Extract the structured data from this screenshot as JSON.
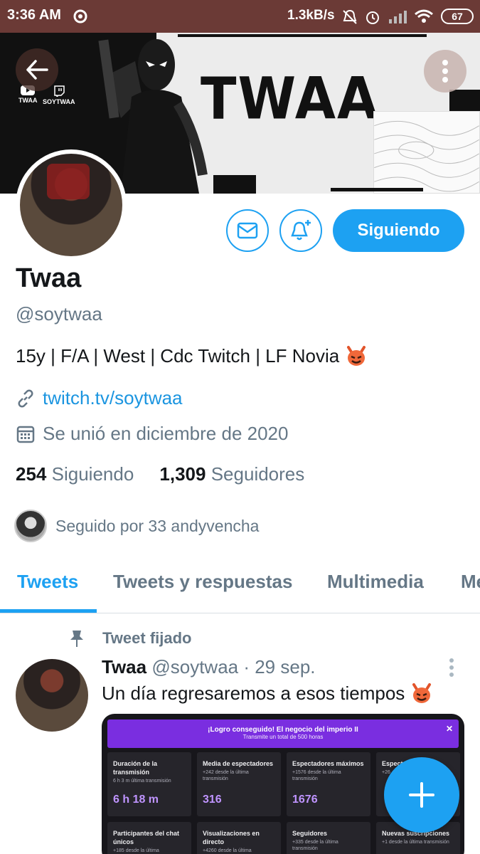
{
  "status_bar": {
    "time": "3:36 AM",
    "net_speed": "1.3kB/s",
    "battery": "67"
  },
  "banner": {
    "word": "TWAA",
    "social_1": "TWAA",
    "social_2": "SOYTWAA"
  },
  "profile": {
    "name": "Twaa",
    "handle": "@soytwaa",
    "bio": "15y | F/A | West | Cdc Twitch | LF Novia",
    "link": "twitch.tv/soytwaa",
    "joined": "Se unió en diciembre de 2020",
    "following_count": "254",
    "following_label": "Siguiendo",
    "followers_count": "1,309",
    "followers_label": "Seguidores",
    "followed_by": "Seguido por 33 andyvencha",
    "follow_button": "Siguiendo"
  },
  "tabs": [
    {
      "label": "Tweets",
      "active": true
    },
    {
      "label": "Tweets y respuestas",
      "active": false
    },
    {
      "label": "Multimedia",
      "active": false
    },
    {
      "label": "Me",
      "active": false
    }
  ],
  "tweet": {
    "pinned_label": "Tweet fijado",
    "author": "Twaa",
    "handle_date": "@soytwaa · 29 sep.",
    "text": "Un día regresaremos a esos tiempos",
    "media": {
      "title": "¡Logro conseguido! El negocio del imperio II",
      "subtitle": "Transmite un total de 500 horas",
      "cards": [
        {
          "title": "Duración de la transmisión",
          "sub": "6 h 3 m última transmisión",
          "value": "6 h 18 m"
        },
        {
          "title": "Media de espectadores",
          "sub": "+242 desde la última transmisión",
          "value": "316"
        },
        {
          "title": "Espectadores máximos",
          "sub": "+1576 desde la última transmisión",
          "value": "1676"
        },
        {
          "title": "Espectadores",
          "sub": "+26",
          "value": ""
        },
        {
          "title": "Participantes del chat únicos",
          "sub": "+185 desde la última",
          "value": ""
        },
        {
          "title": "Visualizaciones en directo",
          "sub": "+4260 desde la última",
          "value": ""
        },
        {
          "title": "Seguidores",
          "sub": "+335 desde la última transmisión",
          "value": ""
        },
        {
          "title": "Nuevas suscripciones",
          "sub": "+1 desde la última transmisión",
          "value": ""
        }
      ]
    }
  },
  "colors": {
    "accent": "#1da1f2",
    "status_bar": "#6b3a36",
    "muted": "#657786",
    "twitch_purple": "#7a2ee0"
  }
}
